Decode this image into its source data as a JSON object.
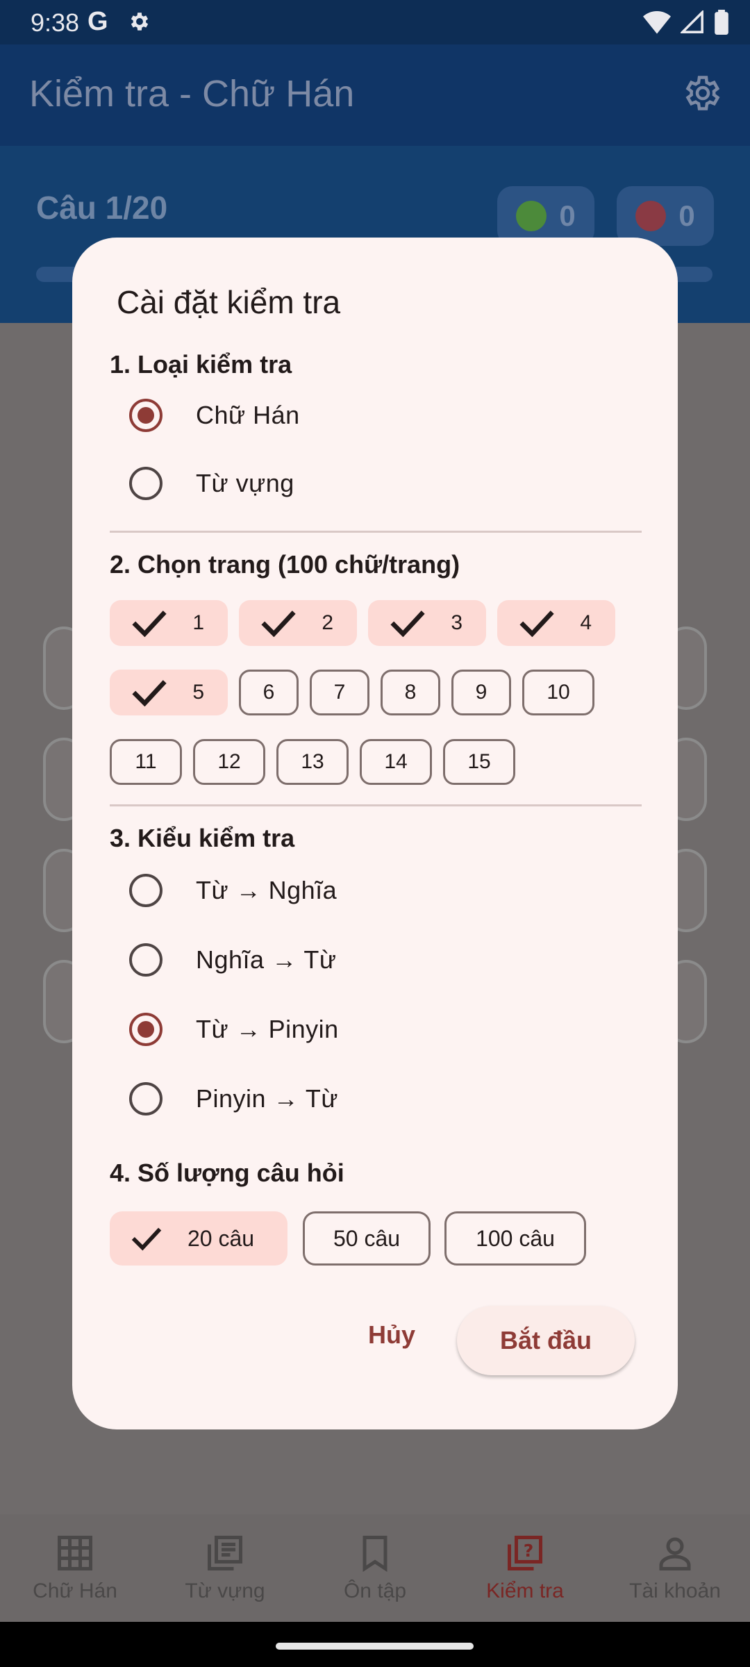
{
  "status_bar": {
    "time": "9:38",
    "g_letter": "G"
  },
  "app_bar": {
    "title": "Kiểm tra - Chữ Hán"
  },
  "quiz_header": {
    "question_counter": "Câu 1/20",
    "correct_count": "0",
    "wrong_count": "0",
    "progress": 0.05
  },
  "colors": {
    "accent": "#8e3b36",
    "chip_selected_bg": "#fddad5",
    "dialog_bg": "#fdf3f2",
    "app_bar_bg": "#103566"
  },
  "dialog": {
    "title": "Cài đặt kiểm tra",
    "section1": {
      "title": "1. Loại kiểm tra",
      "options": [
        "Chữ Hán",
        "Từ vựng"
      ],
      "selected": "Chữ Hán"
    },
    "section2": {
      "title": "2. Chọn trang (100 chữ/trang)",
      "pages": [
        "1",
        "2",
        "3",
        "4",
        "5",
        "6",
        "7",
        "8",
        "9",
        "10",
        "11",
        "12",
        "13",
        "14",
        "15"
      ],
      "selected_pages": [
        "1",
        "2",
        "3",
        "4",
        "5"
      ]
    },
    "section3": {
      "title": "3. Kiểu kiểm tra",
      "options": [
        "Từ → Nghĩa",
        "Nghĩa → Từ",
        "Từ → Pinyin",
        "Pinyin → Từ"
      ],
      "selected": "Từ → Pinyin"
    },
    "section4": {
      "title": "4. Số lượng câu hỏi",
      "options": [
        "20 câu",
        "50 câu",
        "100 câu"
      ],
      "selected": "20 câu"
    },
    "cancel_label": "Hủy",
    "start_label": "Bắt đầu"
  },
  "bottom_nav": {
    "items": [
      {
        "label": "Chữ Hán",
        "icon": "grid-icon"
      },
      {
        "label": "Từ vựng",
        "icon": "list-icon"
      },
      {
        "label": "Ôn tập",
        "icon": "bookmark-icon"
      },
      {
        "label": "Kiểm tra",
        "icon": "quiz-icon",
        "active": true
      },
      {
        "label": "Tài khoản",
        "icon": "person-icon"
      }
    ]
  }
}
